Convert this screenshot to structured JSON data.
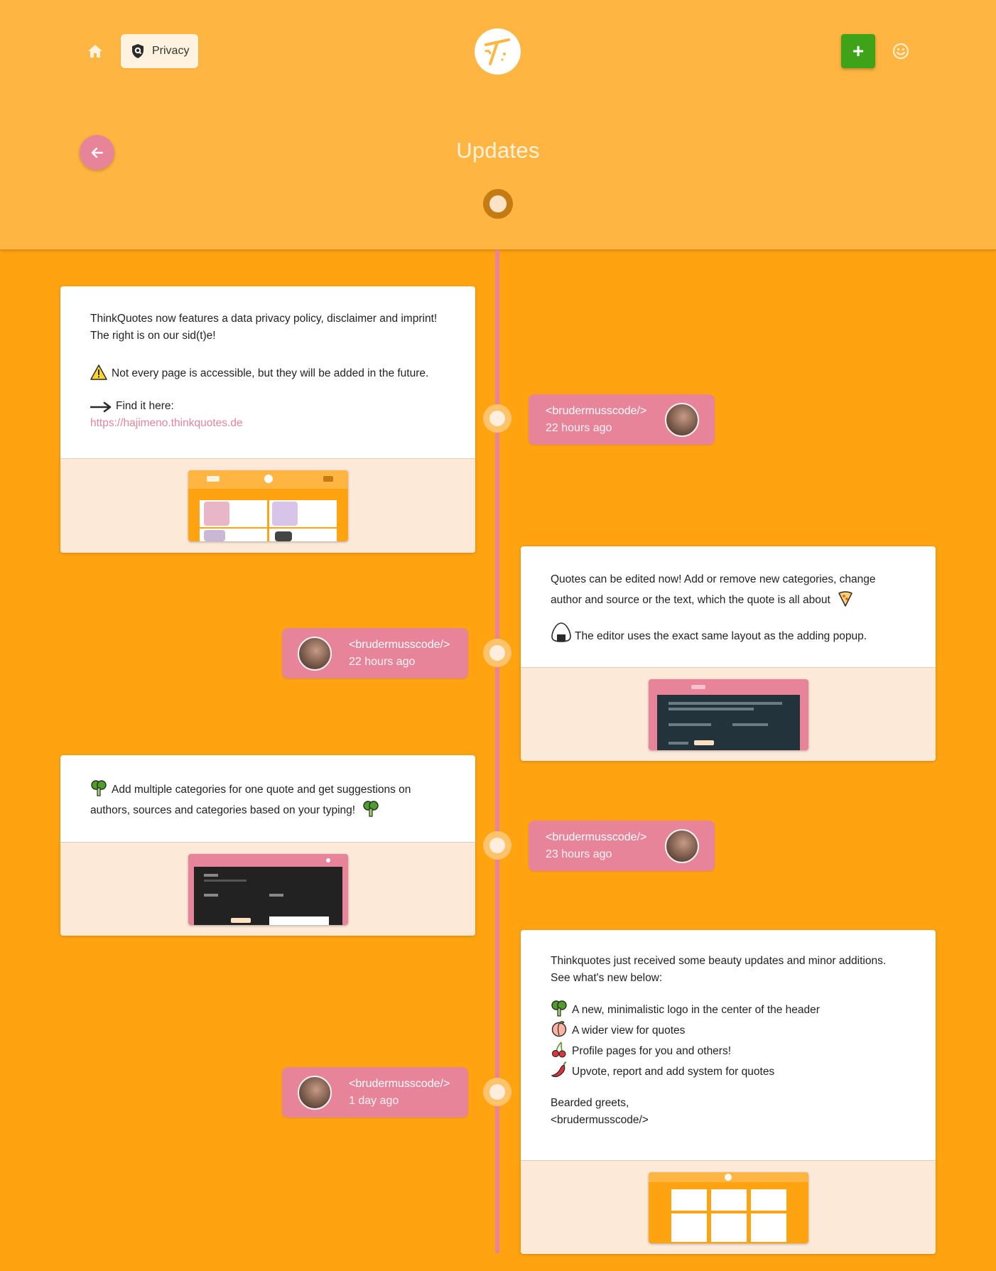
{
  "header": {
    "privacy_label": "Privacy",
    "add_label": "+",
    "page_title": "Updates"
  },
  "colors": {
    "header_bg": "#ffb541",
    "page_bg": "#ffa311",
    "accent_pink": "#e8849a",
    "add_green": "#3fa31a"
  },
  "posts": [
    {
      "author": "<brudermusscode/>",
      "time": "22 hours ago",
      "lines": [
        "ThinkQuotes now features a data privacy policy, disclaimer and imprint!",
        "The right is on our sid(t)e!",
        "Not every page is accessible, but they will be added in the future.",
        "Find it here:"
      ],
      "link": "https://hajimeno.thinkquotes.de",
      "icons": [
        "warning-icon",
        "arrow-right-icon"
      ]
    },
    {
      "author": "<brudermusscode/>",
      "time": "22 hours ago",
      "lines": [
        "Quotes can be edited now! Add or remove new categories, change",
        "author and source or the text, which the quote is all about",
        "The editor uses the exact same layout as the adding popup."
      ],
      "icons": [
        "pizza-icon",
        "rice-ball-icon"
      ]
    },
    {
      "author": "<brudermusscode/>",
      "time": "23 hours ago",
      "lines": [
        "Add multiple categories for one quote and get suggestions on",
        "authors, sources and categories based on your typing!"
      ],
      "icons": [
        "broccoli-icon",
        "broccoli-icon"
      ]
    },
    {
      "author": "<brudermusscode/>",
      "time": "1 day ago",
      "lines": [
        "Thinkquotes just received some beauty updates and minor additions.",
        "See what's new below:",
        "A new, minimalistic logo in the center of the header",
        "A wider view for quotes",
        "Profile pages for you and others!",
        "Upvote, report and add system for quotes",
        "Bearded greets,",
        "<brudermusscode/>"
      ],
      "icons": [
        "broccoli-icon",
        "peach-icon",
        "cherries-icon",
        "hot-pepper-icon"
      ]
    }
  ]
}
